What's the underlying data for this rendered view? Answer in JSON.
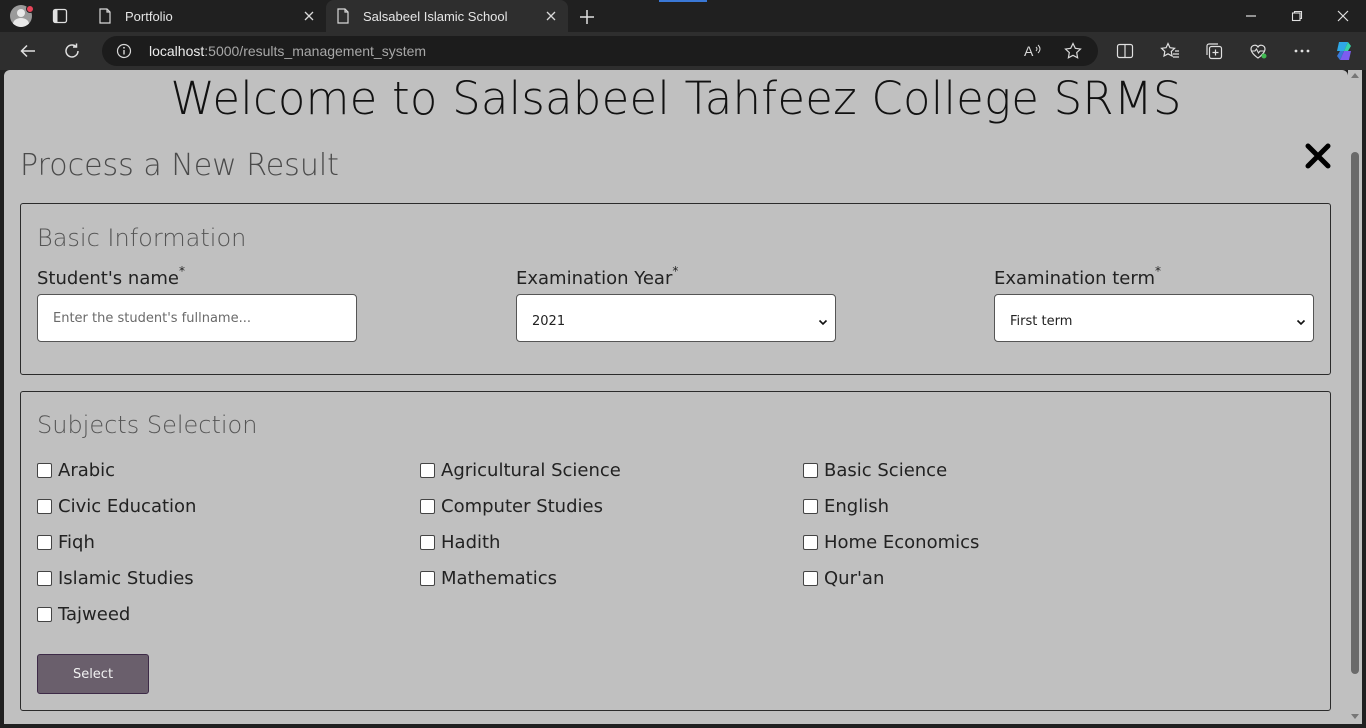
{
  "browser": {
    "tabs": [
      {
        "title": "Portfolio",
        "active": false
      },
      {
        "title": "Salsabeel Islamic School",
        "active": true
      }
    ],
    "url_host": "localhost",
    "url_rest": ":5000/results_management_system",
    "accent_color": "#3a78d6"
  },
  "page": {
    "site_title": "Welcome to Salsabeel Tahfeez College SRMS",
    "heading": "Process a New Result",
    "background_color": "#c0c0c0"
  },
  "basic_info": {
    "legend": "Basic Information",
    "required_mark": "*",
    "student_name": {
      "label": "Student's name",
      "placeholder": "Enter the student's fullname...",
      "value": ""
    },
    "exam_year": {
      "label": "Examination Year",
      "selected": "2021"
    },
    "exam_term": {
      "label": "Examination term",
      "selected": "First term"
    }
  },
  "subjects": {
    "legend": "Subjects Selection",
    "items": [
      {
        "label": "Arabic",
        "checked": false
      },
      {
        "label": "Agricultural Science",
        "checked": false
      },
      {
        "label": "Basic Science",
        "checked": false
      },
      {
        "label": "Civic Education",
        "checked": false
      },
      {
        "label": "Computer Studies",
        "checked": false
      },
      {
        "label": "English",
        "checked": false
      },
      {
        "label": "Fiqh",
        "checked": false
      },
      {
        "label": "Hadith",
        "checked": false
      },
      {
        "label": "Home Economics",
        "checked": false
      },
      {
        "label": "Islamic Studies",
        "checked": false
      },
      {
        "label": "Mathematics",
        "checked": false
      },
      {
        "label": "Qur'an",
        "checked": false
      },
      {
        "label": "Tajweed",
        "checked": false
      }
    ],
    "button_label": "Select",
    "button_color": "#6a5f6c"
  },
  "icons": [
    "profile-icon",
    "tab-actions-icon",
    "page-icon",
    "close-icon",
    "new-tab-icon",
    "minimize-icon",
    "maximize-icon",
    "window-close-icon",
    "back-icon",
    "reload-icon",
    "info-icon",
    "read-aloud-icon",
    "favorite-icon",
    "split-screen-icon",
    "favorites-icon",
    "collections-icon",
    "performance-icon",
    "more-icon",
    "copilot-icon",
    "close-x-icon"
  ]
}
